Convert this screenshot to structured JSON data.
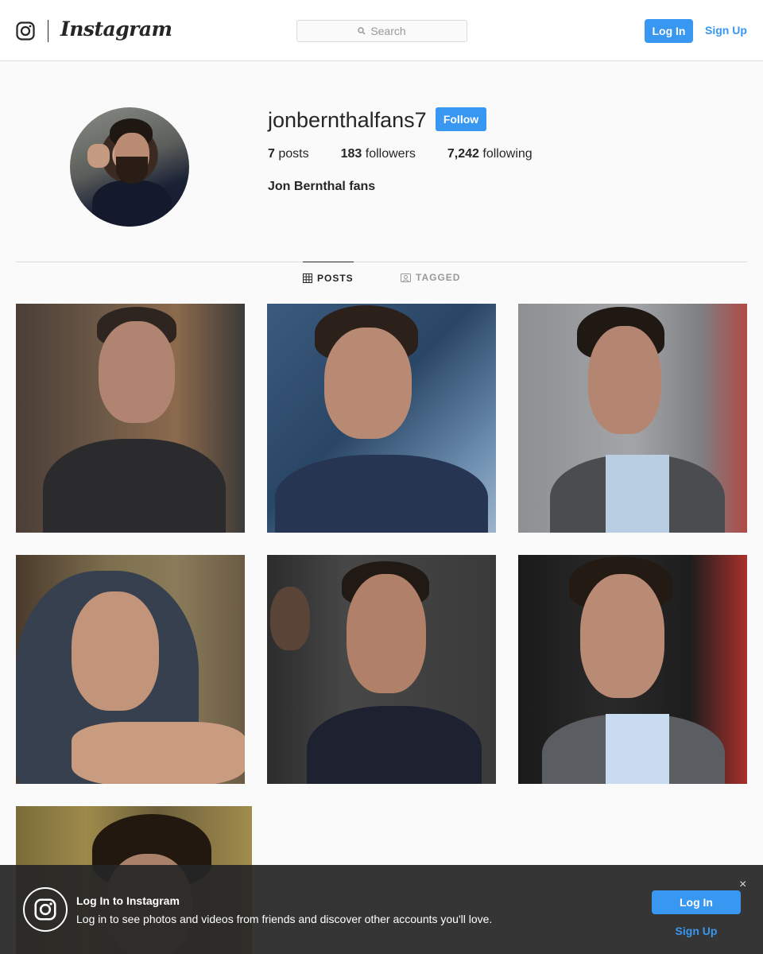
{
  "nav": {
    "brand": "Instagram",
    "search_placeholder": "Search",
    "login_label": "Log In",
    "signup_label": "Sign Up"
  },
  "profile": {
    "username": "jonbernthalfans7",
    "follow_label": "Follow",
    "posts_count": "7",
    "posts_label": "posts",
    "followers_count": "183",
    "followers_label": "followers",
    "following_count": "7,242",
    "following_label": "following",
    "full_name": "Jon Bernthal fans"
  },
  "tabs": [
    {
      "label": "POSTS",
      "icon": "grid-icon",
      "active": true
    },
    {
      "label": "TAGGED",
      "icon": "tagged-icon",
      "active": false
    }
  ],
  "posts_count_visible": 7,
  "banner": {
    "title": "Log In to Instagram",
    "text": "Log in to see photos and videos from friends and discover other accounts you'll love.",
    "login_label": "Log In",
    "signup_label": "Sign Up",
    "close_glyph": "×"
  },
  "colors": {
    "accent": "#3897f0",
    "text": "#262626",
    "border": "#dbdbdb",
    "background": "#fafafa"
  }
}
